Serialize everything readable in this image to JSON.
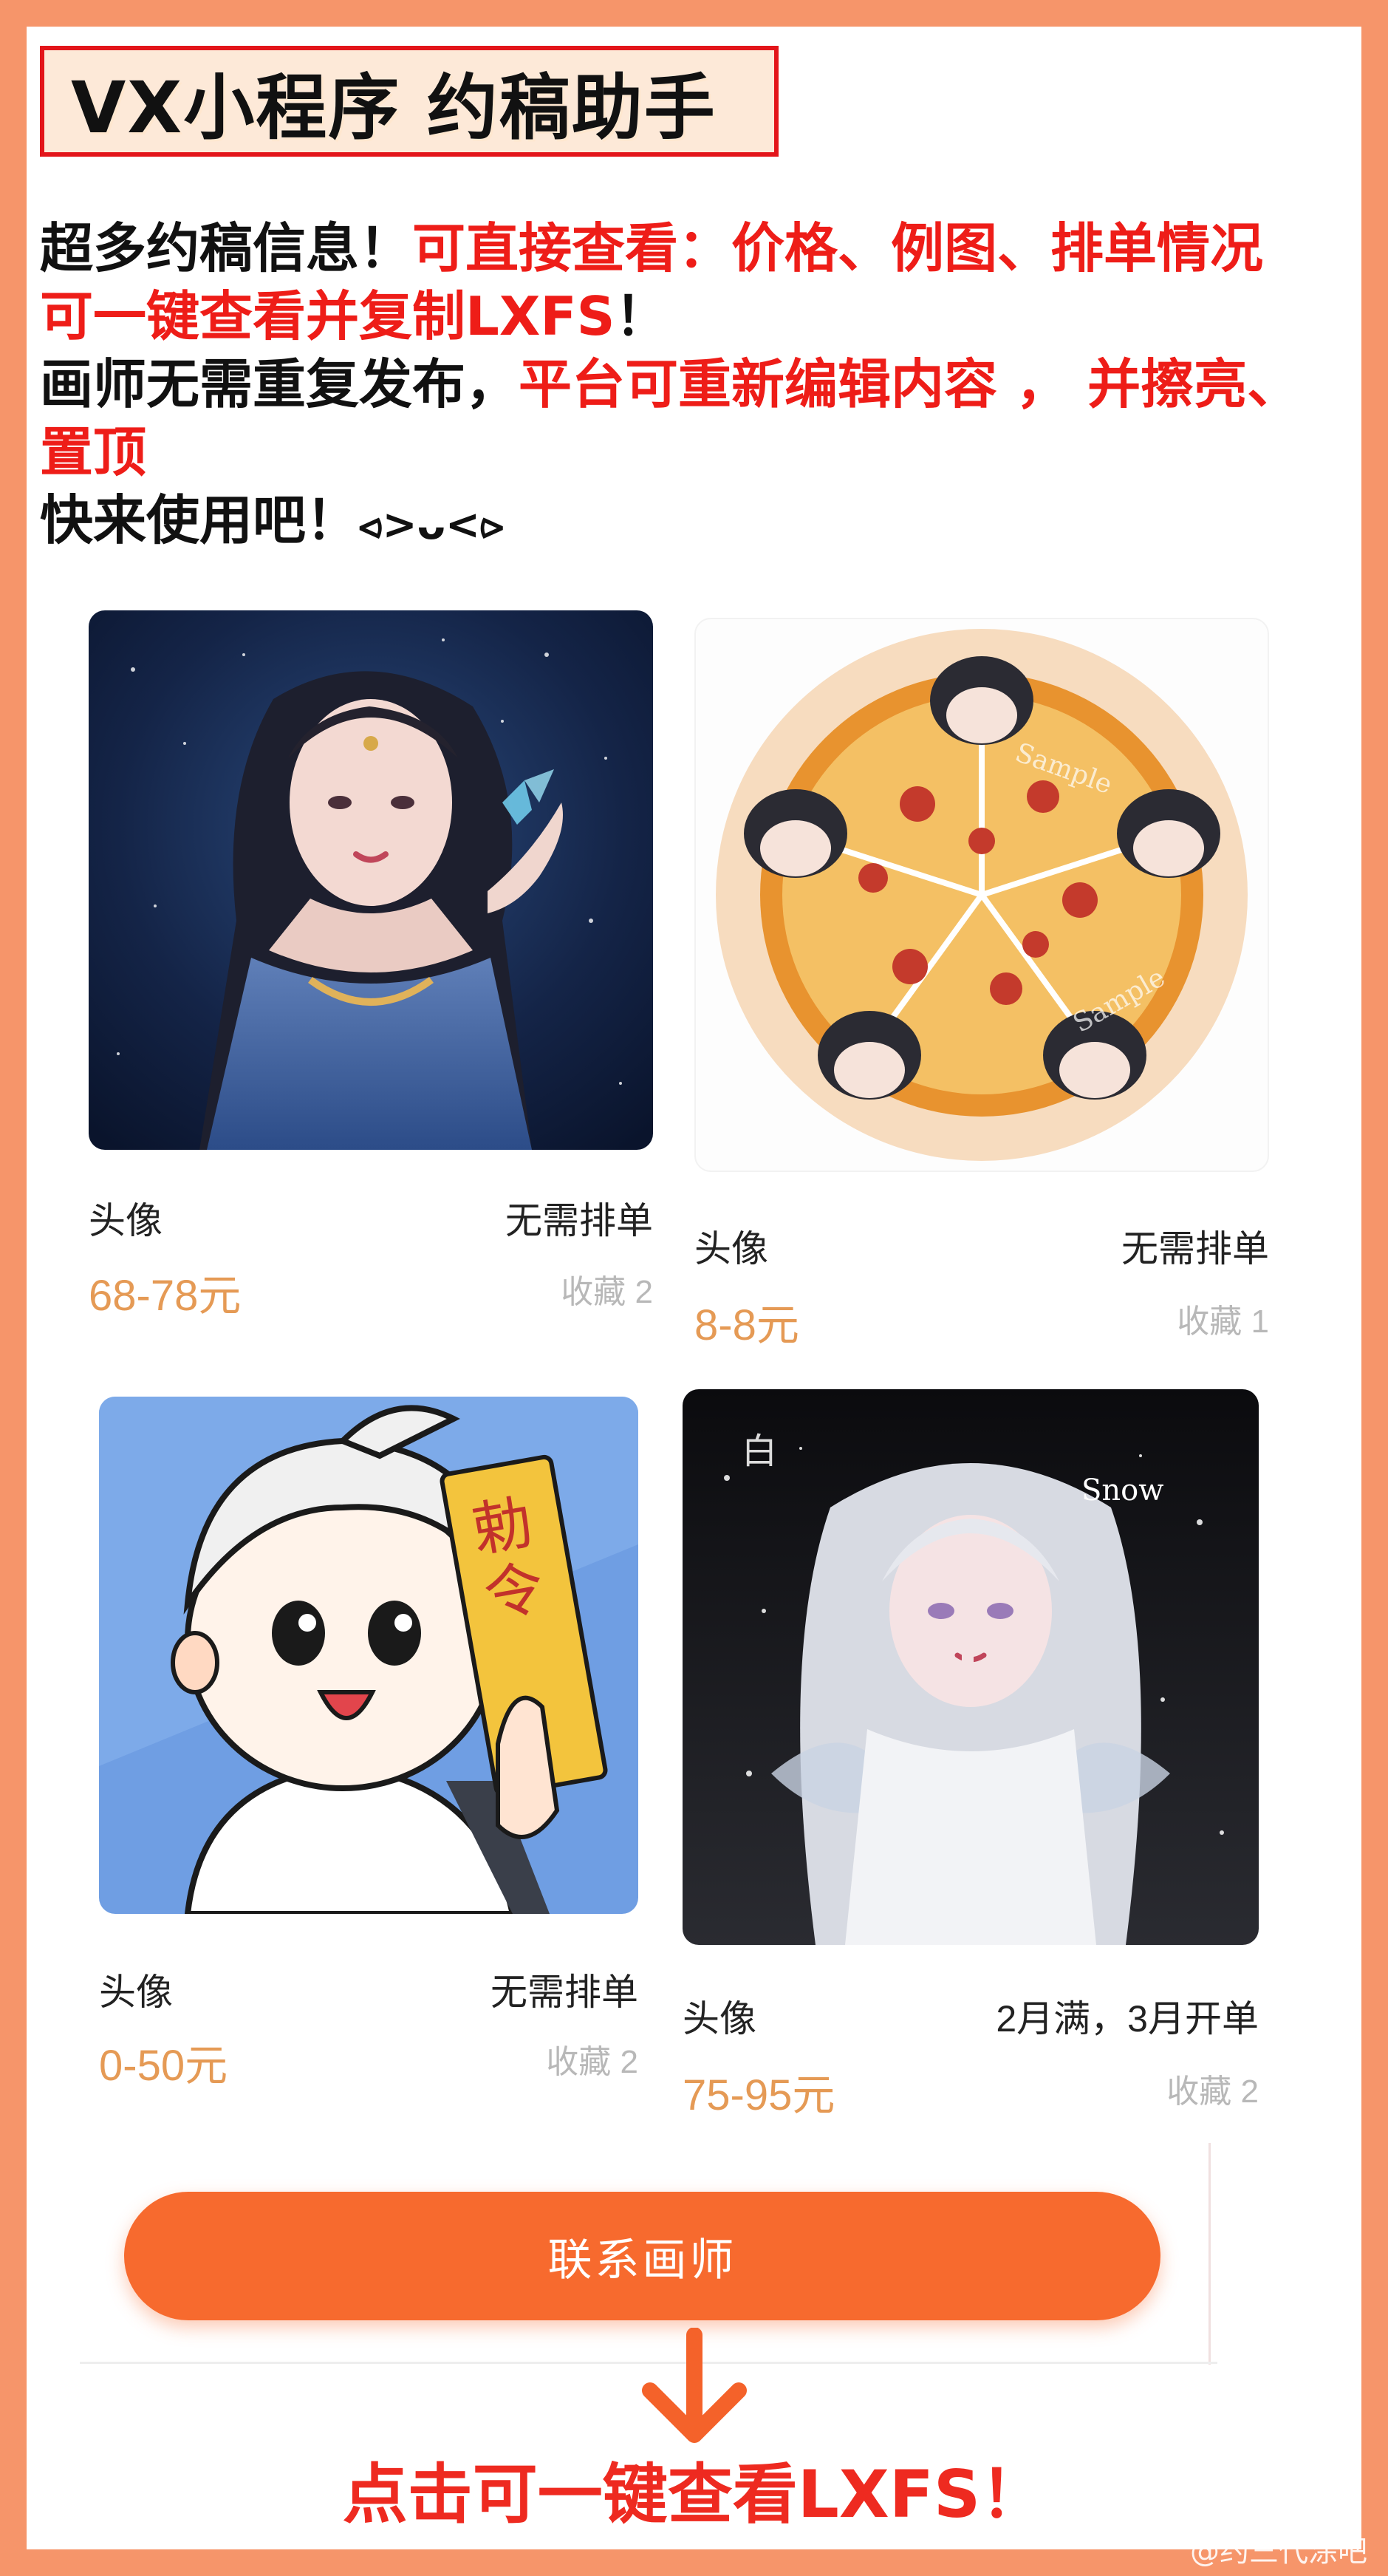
{
  "title": "VX小程序 约稿助手",
  "intro": {
    "line1_black": "超多约稿信息！",
    "line1_red": "可直接查看：价格、例图、排单情况",
    "line2_red": "可一键查看并复制LXFS",
    "line2_black": "！",
    "line3_black": "画师无需重复发布，",
    "line3_red": "平台可重新编辑内容 ， 并擦亮、",
    "line4_red": "置顶",
    "line5_black": "快来使用吧！",
    "line5_emoticon": "⪦>ᴗ<⪧"
  },
  "cards": [
    {
      "type": "头像",
      "status": "无需排单",
      "price": "68-78元",
      "favorites": "收藏 2"
    },
    {
      "type": "头像",
      "status": "无需排单",
      "price": "8-8元",
      "favorites": "收藏 1"
    },
    {
      "type": "头像",
      "status": "无需排单",
      "price": "0-50元",
      "favorites": "收藏 2"
    },
    {
      "type": "头像",
      "status": "2月满，3月开单",
      "price": "75-95元",
      "favorites": "收藏 2"
    }
  ],
  "contact_button": "联系画师",
  "bottom_cta": "点击可一键查看LXFS！",
  "watermark": "@约三代涂吧",
  "colors": {
    "frame": "#f6956a",
    "accent_red": "#ee1d18",
    "button": "#f76a2e",
    "price": "#e59a55"
  }
}
